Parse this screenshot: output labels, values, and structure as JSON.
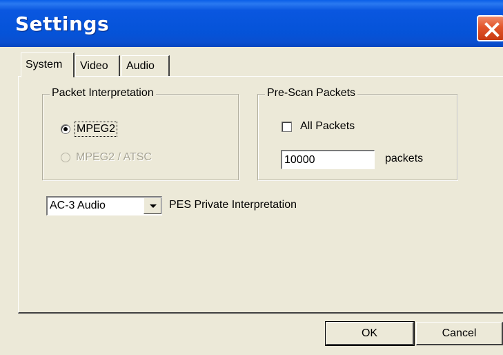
{
  "window": {
    "title": "Settings",
    "close_icon": "close-icon"
  },
  "tabs": [
    {
      "label": "System",
      "active": true
    },
    {
      "label": "Video",
      "active": false
    },
    {
      "label": "Audio",
      "active": false
    }
  ],
  "packet_interpretation": {
    "legend": "Packet Interpretation",
    "options": [
      {
        "label": "MPEG2",
        "selected": true,
        "enabled": true
      },
      {
        "label": "MPEG2 / ATSC",
        "selected": false,
        "enabled": false
      }
    ]
  },
  "prescan_packets": {
    "legend": "Pre-Scan Packets",
    "all_packets_label": "All Packets",
    "all_packets_checked": false,
    "count_value": "10000",
    "count_unit": "packets"
  },
  "pes_private": {
    "selected": "AC-3 Audio",
    "label": "PES Private Interpretation"
  },
  "buttons": {
    "ok": "OK",
    "cancel": "Cancel"
  }
}
